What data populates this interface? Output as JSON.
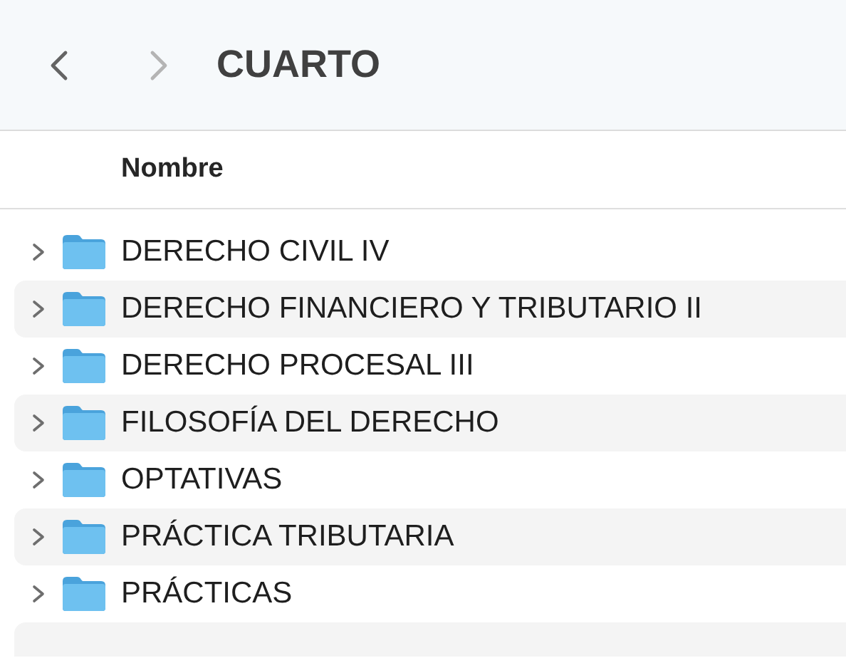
{
  "toolbar": {
    "back": {
      "disabled": false
    },
    "forward": {
      "disabled": true
    },
    "title": "CUARTO"
  },
  "table": {
    "columns": [
      "Nombre"
    ],
    "rows": [
      {
        "name": "DERECHO CIVIL IV",
        "expanded": false
      },
      {
        "name": "DERECHO FINANCIERO Y TRIBUTARIO II",
        "expanded": false
      },
      {
        "name": "DERECHO PROCESAL III",
        "expanded": false
      },
      {
        "name": "FILOSOFÍA DEL DERECHO",
        "expanded": false
      },
      {
        "name": "OPTATIVAS",
        "expanded": false
      },
      {
        "name": "PRÁCTICA TRIBUTARIA",
        "expanded": false
      },
      {
        "name": "PRÁCTICAS",
        "expanded": false
      }
    ]
  }
}
